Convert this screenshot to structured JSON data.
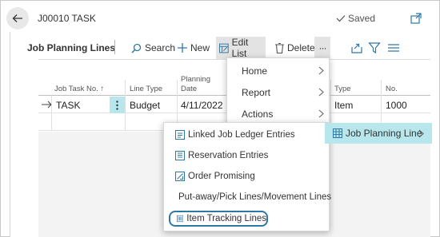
{
  "header": {
    "title": "J00010 TASK",
    "saved_label": "Saved"
  },
  "toolbar": {
    "title": "Job Planning Lines",
    "search_label": "Search",
    "new_label": "New",
    "edit_list_label": "Edit List",
    "delete_label": "Delete",
    "more_label": "···"
  },
  "grid": {
    "columns": {
      "job_task_no": "Job Task No. ↑",
      "line_type": "Line Type",
      "planning_date_1": "Planning",
      "planning_date_2": "Date",
      "type": "Type",
      "no": "No."
    },
    "row": {
      "job_task_no": "TASK",
      "line_type": "Budget",
      "planning_date": "4/11/2022",
      "type": "Item",
      "no": "1000"
    }
  },
  "menu": {
    "items": [
      {
        "label": "Home"
      },
      {
        "label": "Report"
      },
      {
        "label": "Actions"
      }
    ]
  },
  "flyout": {
    "label": "Job Planning Line"
  },
  "submenu": {
    "items": [
      {
        "label": "Linked Job Ledger Entries"
      },
      {
        "label": "Reservation Entries"
      },
      {
        "label": "Order Promising"
      },
      {
        "label": "Put-away/Pick Lines/Movement Lines"
      },
      {
        "label": "Item Tracking Lines"
      }
    ]
  },
  "colors": {
    "accent": "#2e78a6",
    "flyout_bg": "#b7e6ec",
    "selected_cell": "#b7e6ec"
  }
}
